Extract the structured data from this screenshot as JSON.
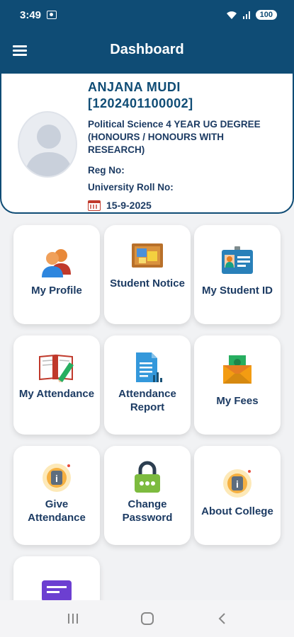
{
  "status_bar": {
    "time": "3:49",
    "battery": "100"
  },
  "app_bar": {
    "title": "Dashboard",
    "color": "#0f4c75"
  },
  "profile": {
    "name": "ANJANA  MUDI",
    "id": "[1202401100002]",
    "course": "Political Science 4 YEAR UG DEGREE (HONOURS / HONOURS WITH RESEARCH)",
    "reg_label": "Reg No:",
    "roll_label": "University Roll No:",
    "date": "15-9-2025"
  },
  "tiles": [
    {
      "label": "My Profile",
      "icon": "users-icon"
    },
    {
      "label": "Student Notice",
      "icon": "notice-board-icon"
    },
    {
      "label": "My Student ID",
      "icon": "id-card-icon"
    },
    {
      "label": "My Attendance",
      "icon": "book-pencil-icon"
    },
    {
      "label": "Attendance Report",
      "icon": "report-document-icon"
    },
    {
      "label": "My Fees",
      "icon": "money-envelope-icon"
    },
    {
      "label": "Give Attendance",
      "icon": "info-badge-icon"
    },
    {
      "label": "Change Password",
      "icon": "padlock-icon"
    },
    {
      "label": "About College",
      "icon": "info-badge-icon"
    },
    {
      "label": "",
      "icon": "message-icon"
    }
  ]
}
